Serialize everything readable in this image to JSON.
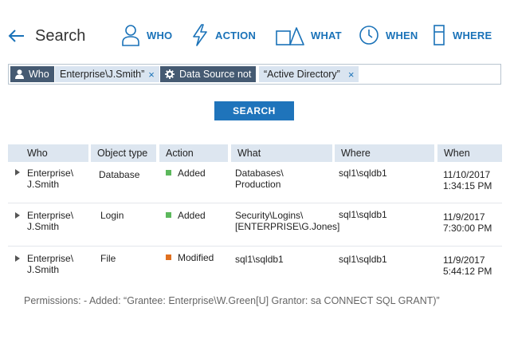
{
  "header": {
    "title": "Search",
    "tabs": [
      {
        "label": "WHO",
        "icon": "person-icon"
      },
      {
        "label": "ACTION",
        "icon": "lightning-icon"
      },
      {
        "label": "WHAT",
        "icon": "shapes-icon"
      },
      {
        "label": "WHEN",
        "icon": "clock-icon"
      },
      {
        "label": "WHERE",
        "icon": "server-icon"
      }
    ]
  },
  "filters": [
    {
      "key": "Who",
      "key_icon": "person-icon",
      "value": "Enterprise\\J.Smith”"
    },
    {
      "key": "Data Source not",
      "key_icon": "gear-icon",
      "value": "“Active Directory”"
    }
  ],
  "search_button": "SEARCH",
  "table": {
    "columns": [
      "Who",
      "Object type",
      "Action",
      "What",
      "Where",
      "When"
    ],
    "rows": [
      {
        "who": [
          "Enterprise\\",
          "J.Smith"
        ],
        "object_type": "Database",
        "action": "Added",
        "action_color": "#5cb85c",
        "what": [
          "Databases\\",
          "Production"
        ],
        "where": "sql1\\sqldb1",
        "when": [
          "11/10/2017",
          "1:34:15 PM"
        ]
      },
      {
        "who": [
          "Enterprise\\",
          "J.Smith"
        ],
        "object_type": "Login",
        "action": "Added",
        "action_color": "#5cb85c",
        "what": [
          "Security\\Logins\\",
          "[ENTERPRISE\\G.Jones]"
        ],
        "where": "sql1\\sqldb1",
        "when": [
          "11/9/2017",
          "7:30:00 PM"
        ]
      },
      {
        "who": [
          "Enterprise\\",
          "J.Smith"
        ],
        "object_type": "File",
        "action": "Modified",
        "action_color": "#e07020",
        "what": [
          "sql1\\sqldb1",
          ""
        ],
        "where": "sql1\\sqldb1",
        "when": [
          "11/9/2017",
          "5:44:12 PM"
        ]
      }
    ]
  },
  "details": "Permissions: - Added: “Grantee: Enterprise\\W.Green[U] Grantor: sa CONNECT SQL GRANT)”",
  "colors": {
    "accent": "#1f74bb",
    "chip_key_bg": "#455a72",
    "chip_value_bg": "#d9e4f0",
    "header_bg": "#dde6f0"
  }
}
